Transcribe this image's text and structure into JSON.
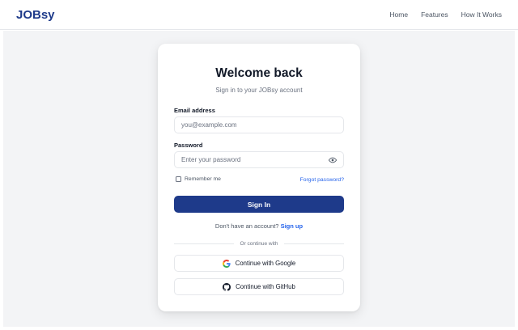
{
  "navbar": {
    "brand": "JOBsy",
    "links": [
      "Home",
      "Features",
      "How It Works"
    ]
  },
  "login": {
    "title": "Welcome back",
    "subtitle": "Sign in to your JOBsy account",
    "email": {
      "label": "Email address",
      "placeholder": "you@example.com",
      "value": ""
    },
    "password": {
      "label": "Password",
      "placeholder": "Enter your password",
      "value": ""
    },
    "remember_label": "Remember me",
    "remember_checked": false,
    "forgot_label": "Forgot password?",
    "submit_label": "Sign In",
    "signup_prompt": "Don't have an account?",
    "signup_link": "Sign up",
    "divider_text": "Or continue with",
    "google_label": "Continue with Google",
    "github_label": "Continue with GitHub"
  },
  "colors": {
    "brand": "#1e3a8a",
    "link": "#2563eb",
    "page_bg": "#f3f4f6"
  }
}
